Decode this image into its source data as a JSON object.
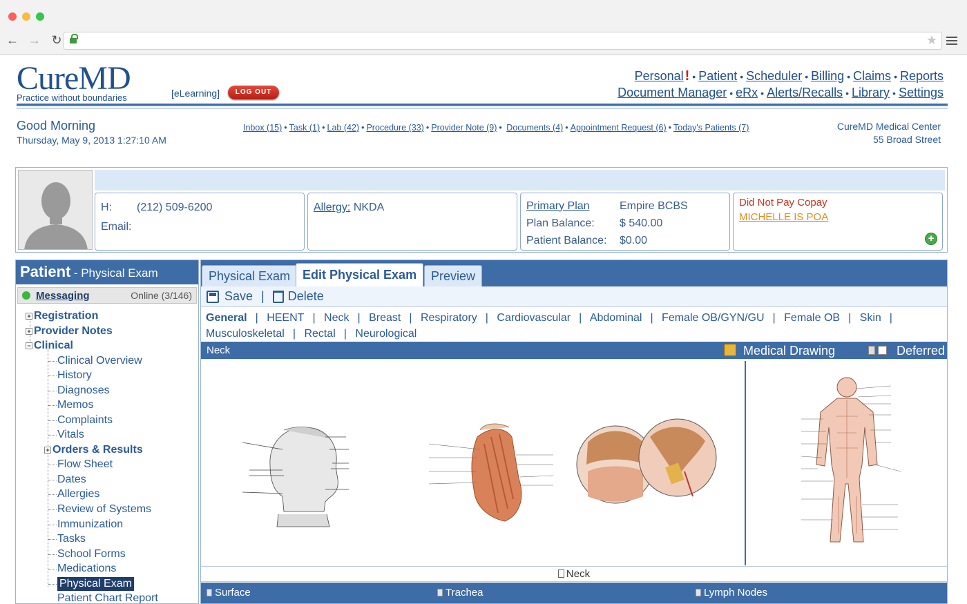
{
  "app": {
    "logo": "CureMD",
    "tagline": "Practice without boundaries",
    "elearning": "[eLearning]",
    "logout": "LOG OUT"
  },
  "topnav": {
    "row1": [
      "Personal",
      "Patient",
      "Scheduler",
      "Billing",
      "Claims",
      "Reports"
    ],
    "row2": [
      "Document Manager",
      "eRx",
      "Alerts/Recalls",
      "Library",
      "Settings"
    ],
    "alert_mark": "!"
  },
  "greeting": {
    "text": "Good Morning",
    "datetime": "Thursday, May 9, 2013 1:27:10 AM"
  },
  "quicklinks": [
    "Inbox (15)",
    "Task (1)",
    "Lab (42)",
    "Procedure (33)",
    "Provider Note (9)",
    "Documents (4)",
    "Appointment Request (6)",
    "Today's Patients (7)"
  ],
  "center": {
    "name": "CureMD Medical Center",
    "address": "55 Broad Street"
  },
  "patient": {
    "phone_label": "H:",
    "phone": "(212) 509-6200",
    "email_label": "Email:",
    "allergy_label": "Allergy:",
    "allergy_value": "NKDA",
    "primary_plan_label": "Primary Plan",
    "primary_plan": "Empire BCBS",
    "plan_balance_label": "Plan Balance:",
    "plan_balance": "$ 540.00",
    "patient_balance_label": "Patient Balance:",
    "patient_balance": "$0.00",
    "warning": "Did Not Pay Copay",
    "poa": "MICHELLE IS POA"
  },
  "leftpanel": {
    "title": "Patient",
    "subtitle": "- Physical Exam",
    "messaging_label": "Messaging",
    "online": "Online (3/146)",
    "tree": {
      "registration": "Registration",
      "provider_notes": "Provider Notes",
      "clinical": "Clinical",
      "children": [
        "Clinical Overview",
        "History",
        "Diagnoses",
        "Memos",
        "Complaints",
        "Vitals",
        "Orders & Results",
        "Flow Sheet",
        "Dates",
        "Allergies",
        "Review of Systems",
        "Immunization",
        "Tasks",
        "School Forms",
        "Medications",
        "Physical Exam",
        "Patient Chart Report"
      ]
    }
  },
  "tabs": [
    "Physical Exam",
    "Edit Physical Exam",
    "Preview"
  ],
  "toolbar": {
    "save": "Save",
    "delete": "Delete"
  },
  "sections": [
    "General",
    "HEENT",
    "Neck",
    "Breast",
    "Respiratory",
    "Cardiovascular",
    "Abdominal",
    "Female OB/GYN/GU",
    "Female OB",
    "Skin",
    "Musculoskeletal",
    "Rectal",
    "Neurological"
  ],
  "exam": {
    "section_title": "Neck",
    "medical_drawing": "Medical Drawing",
    "deferred": "Deferred",
    "caption": "Neck",
    "subsections": [
      "Surface",
      "Trachea",
      "Lymph Nodes"
    ]
  },
  "colors": {
    "primary": "#3d6ca6",
    "link": "#2a5a96",
    "light": "#dbe8f7",
    "logout": "#c8281b",
    "warning": "#c8331b",
    "poa": "#e38b1a"
  }
}
